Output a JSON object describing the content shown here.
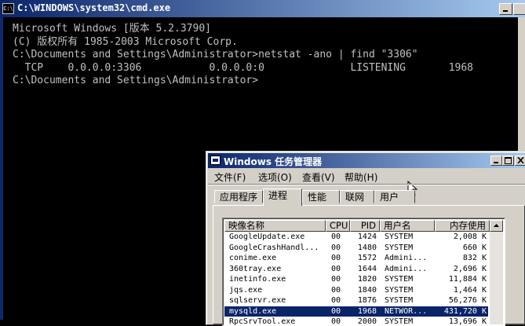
{
  "cmd": {
    "title": "C:\\WINDOWS\\system32\\cmd.exe",
    "icon_text": "C:\\",
    "lines": [
      "Microsoft Windows [版本 5.2.3790]",
      "(C) 版权所有 1985-2003 Microsoft Corp.",
      "",
      "C:\\Documents and Settings\\Administrator>netstat -ano | find \"3306\"",
      "  TCP    0.0.0.0:3306           0.0.0.0:0              LISTENING       1968",
      "",
      "C:\\Documents and Settings\\Administrator>"
    ]
  },
  "taskmgr": {
    "title": "Windows 任务管理器",
    "menu": {
      "file": "文件(F)",
      "options": "选项(O)",
      "view": "查看(V)",
      "help": "帮助(H)"
    },
    "tabs": {
      "apps": "应用程序",
      "processes": "进程",
      "performance": "性能",
      "network": "联网",
      "users": "用户"
    },
    "columns": {
      "name": "映像名称",
      "cpu": "CPU",
      "pid": "PID",
      "user": "用户名",
      "mem": "内存使用"
    },
    "rows": [
      {
        "name": "GoogleUpdate.exe",
        "cpu": "00",
        "pid": "1424",
        "user": "SYSTEM",
        "mem": "2,008 K"
      },
      {
        "name": "GoogleCrashHandl...",
        "cpu": "00",
        "pid": "1480",
        "user": "SYSTEM",
        "mem": "660 K"
      },
      {
        "name": "conime.exe",
        "cpu": "00",
        "pid": "1572",
        "user": "Admini...",
        "mem": "832 K"
      },
      {
        "name": "360tray.exe",
        "cpu": "00",
        "pid": "1644",
        "user": "Admini...",
        "mem": "2,696 K"
      },
      {
        "name": "inetinfo.exe",
        "cpu": "00",
        "pid": "1820",
        "user": "SYSTEM",
        "mem": "11,884 K"
      },
      {
        "name": "jqs.exe",
        "cpu": "00",
        "pid": "1840",
        "user": "SYSTEM",
        "mem": "1,464 K"
      },
      {
        "name": "sqlservr.exe",
        "cpu": "00",
        "pid": "1876",
        "user": "SYSTEM",
        "mem": "56,276 K"
      },
      {
        "name": "mysqld.exe",
        "cpu": "00",
        "pid": "1968",
        "user": "NETWOR...",
        "mem": "431,720 K"
      },
      {
        "name": "RpcSrvTool.exe",
        "cpu": "00",
        "pid": "2000",
        "user": "SYSTEM",
        "mem": "13,696 K"
      }
    ],
    "selected_row": 7
  },
  "colors": {
    "titlebar_start": "#0a246a",
    "titlebar_end": "#a6caf0",
    "console_text": "#c0c0c0",
    "selection": "#0a246a",
    "chrome": "#d4d0c8"
  }
}
